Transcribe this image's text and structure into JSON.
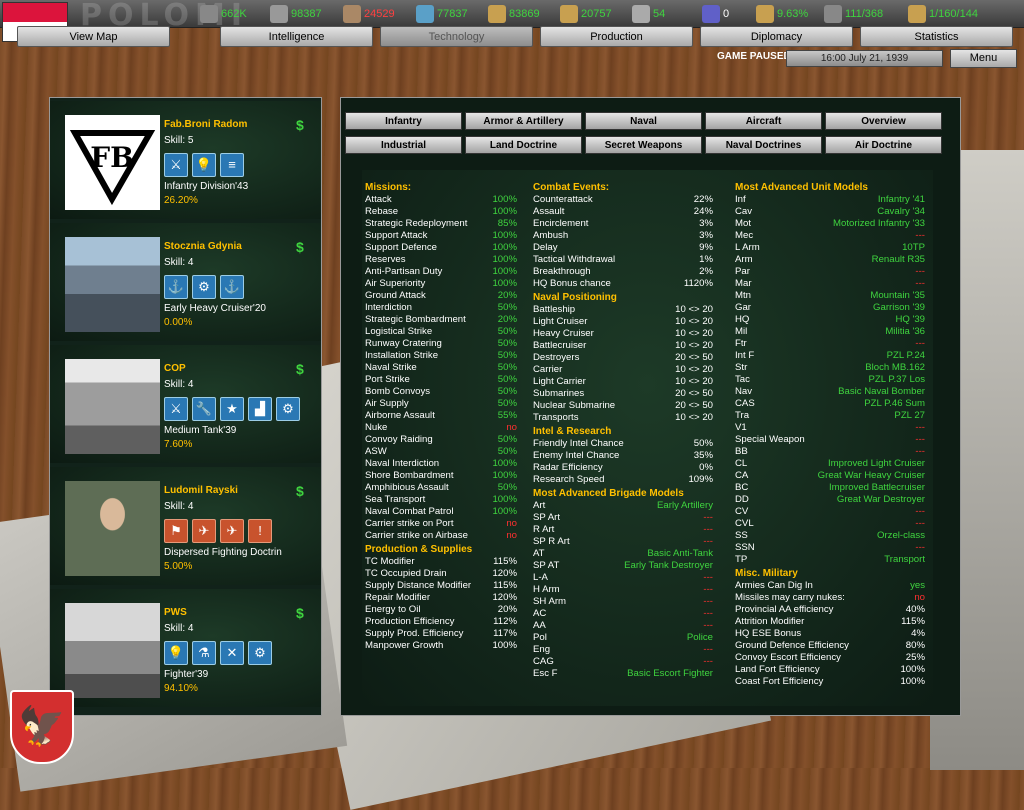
{
  "header": {
    "country_name": "POLOMI",
    "resources": [
      {
        "icon": "leadership-icon",
        "value": "662K"
      },
      {
        "icon": "energy-icon",
        "value": "98387"
      },
      {
        "icon": "metal-icon",
        "value": "24529"
      },
      {
        "icon": "rare-materials-icon",
        "value": "77837"
      },
      {
        "icon": "crude-oil-icon",
        "value": "83869"
      },
      {
        "icon": "supplies-icon",
        "value": "20757"
      },
      {
        "icon": "manpower-icon",
        "value": "54"
      },
      {
        "icon": "nuclear-icon",
        "value": "0"
      },
      {
        "icon": "dissent-icon",
        "value": "9.63%"
      },
      {
        "icon": "convoy-icon",
        "value": "111/368"
      },
      {
        "icon": "research-icon",
        "value": "1/160/144"
      }
    ],
    "tabs": [
      "View Map",
      "Intelligence",
      "Technology",
      "Production",
      "Diplomacy",
      "Statistics"
    ],
    "status": "GAME PAUSED",
    "date": "16:00 July 21, 1939",
    "menu": "Menu"
  },
  "teams": [
    {
      "name": "Fab.Broni Radom",
      "skill": "Skill: 5",
      "model": "Infantry Division'43",
      "pct": "26.20%",
      "icons": [
        "infantry-icon",
        "research-bulb-icon",
        "document-icon"
      ],
      "red": false
    },
    {
      "name": "Stocznia Gdynia",
      "skill": "Skill: 4",
      "model": "Early Heavy Cruiser'20",
      "pct": "0.00%",
      "icons": [
        "anchor-icon",
        "gears-icon",
        "ship-icon"
      ],
      "red": false
    },
    {
      "name": "COP",
      "skill": "Skill: 4",
      "model": "Medium Tank'39",
      "pct": "7.60%",
      "icons": [
        "infantry-icon",
        "wrench-icon",
        "star-icon",
        "industry-icon",
        "gears-icon"
      ],
      "red": false
    },
    {
      "name": "Ludomil Rayski",
      "skill": "Skill: 4",
      "model": "Dispersed Fighting Doctrin",
      "pct": "5.00%",
      "icons": [
        "hq-icon",
        "artillery-icon",
        "fighter-plane-icon",
        "marker-icon"
      ],
      "red": true
    },
    {
      "name": "PWS",
      "skill": "Skill: 4",
      "model": "Fighter'39",
      "pct": "94.10%",
      "icons": [
        "research-bulb-icon",
        "flask-icon",
        "propeller-icon",
        "gears-icon"
      ],
      "red": false
    }
  ],
  "category_tabs": [
    [
      "Infantry",
      "Armor & Artillery",
      "Naval",
      "Aircraft",
      "Overview"
    ],
    [
      "Industrial",
      "Land Doctrine",
      "Secret Weapons",
      "Naval Doctrines",
      "Air Doctrine"
    ]
  ],
  "col1": [
    {
      "h": "Missions:"
    },
    {
      "l": "Attack",
      "v": "100%"
    },
    {
      "l": "Rebase",
      "v": "100%"
    },
    {
      "l": "Strategic Redeployment",
      "v": "85%"
    },
    {
      "l": "Support Attack",
      "v": "100%"
    },
    {
      "l": "Support Defence",
      "v": "100%"
    },
    {
      "l": "Reserves",
      "v": "100%"
    },
    {
      "l": "Anti-Partisan Duty",
      "v": "100%"
    },
    {
      "l": "Air Superiority",
      "v": "100%"
    },
    {
      "l": "Ground Attack",
      "v": "20%"
    },
    {
      "l": "Interdiction",
      "v": "50%"
    },
    {
      "l": "Strategic Bombardment",
      "v": "20%"
    },
    {
      "l": "Logistical Strike",
      "v": "50%"
    },
    {
      "l": "Runway Cratering",
      "v": "50%"
    },
    {
      "l": "Installation Strike",
      "v": "50%"
    },
    {
      "l": "Naval Strike",
      "v": "50%"
    },
    {
      "l": "Port Strike",
      "v": "50%"
    },
    {
      "l": "Bomb Convoys",
      "v": "50%"
    },
    {
      "l": "Air Supply",
      "v": "50%"
    },
    {
      "l": "Airborne Assault",
      "v": "55%"
    },
    {
      "l": "Nuke",
      "v": "no",
      "c": "red"
    },
    {
      "l": "Convoy Raiding",
      "v": "50%"
    },
    {
      "l": "ASW",
      "v": "50%"
    },
    {
      "l": "Naval Interdiction",
      "v": "100%"
    },
    {
      "l": "Shore Bombardment",
      "v": "100%"
    },
    {
      "l": "Amphibious Assault",
      "v": "50%"
    },
    {
      "l": "Sea Transport",
      "v": "100%"
    },
    {
      "l": "Naval Combat Patrol",
      "v": "100%"
    },
    {
      "l": "Carrier strike on Port",
      "v": "no",
      "c": "red"
    },
    {
      "l": "Carrier strike on Airbase",
      "v": "no",
      "c": "red"
    },
    {
      "h": "Production & Supplies"
    },
    {
      "l": "TC Modifier",
      "v": "115%",
      "c": "white"
    },
    {
      "l": "TC Occupied Drain",
      "v": "120%",
      "c": "white"
    },
    {
      "l": "Supply Distance Modifier",
      "v": "115%",
      "c": "white"
    },
    {
      "l": "Repair Modifier",
      "v": "120%",
      "c": "white"
    },
    {
      "l": "Energy to Oil",
      "v": "20%",
      "c": "white"
    },
    {
      "l": "Production Efficiency",
      "v": "112%",
      "c": "white"
    },
    {
      "l": "Supply Prod. Efficiency",
      "v": "117%",
      "c": "white"
    },
    {
      "l": "Manpower Growth",
      "v": "100%",
      "c": "white"
    }
  ],
  "col2": [
    {
      "h": "Combat Events:"
    },
    {
      "l": "Counterattack",
      "v": "22%",
      "c": "white"
    },
    {
      "l": "Assault",
      "v": "24%",
      "c": "white"
    },
    {
      "l": "Encirclement",
      "v": "3%",
      "c": "white"
    },
    {
      "l": "Ambush",
      "v": "3%",
      "c": "white"
    },
    {
      "l": "Delay",
      "v": "9%",
      "c": "white"
    },
    {
      "l": "Tactical Withdrawal",
      "v": "1%",
      "c": "white"
    },
    {
      "l": "Breakthrough",
      "v": "2%",
      "c": "white"
    },
    {
      "l": "HQ Bonus chance",
      "v": "1120%",
      "c": "white"
    },
    {
      "h": "Naval Positioning"
    },
    {
      "l": "Battleship",
      "v": "10 <> 20",
      "c": "white"
    },
    {
      "l": "Light Cruiser",
      "v": "10 <> 20",
      "c": "white"
    },
    {
      "l": "Heavy Cruiser",
      "v": "10 <> 20",
      "c": "white"
    },
    {
      "l": "Battlecruiser",
      "v": "10 <> 20",
      "c": "white"
    },
    {
      "l": "Destroyers",
      "v": "20 <> 50",
      "c": "white"
    },
    {
      "l": "Carrier",
      "v": "10 <> 20",
      "c": "white"
    },
    {
      "l": "Light Carrier",
      "v": "10 <> 20",
      "c": "white"
    },
    {
      "l": "Submarines",
      "v": "20 <> 50",
      "c": "white"
    },
    {
      "l": "Nuclear Submarine",
      "v": "20 <> 50",
      "c": "white"
    },
    {
      "l": "Transports",
      "v": "10 <> 20",
      "c": "white"
    },
    {
      "h": "Intel & Research"
    },
    {
      "l": "Friendly Intel Chance",
      "v": "50%",
      "c": "white"
    },
    {
      "l": "Enemy Intel Chance",
      "v": "35%",
      "c": "white"
    },
    {
      "l": "Radar Efficiency",
      "v": "0%",
      "c": "white"
    },
    {
      "l": "Research Speed",
      "v": "109%",
      "c": "white"
    },
    {
      "h": "Most Advanced Brigade Models"
    },
    {
      "l": "Art",
      "v": "Early Artillery"
    },
    {
      "l": "SP Art",
      "v": "---",
      "c": "red"
    },
    {
      "l": "R Art",
      "v": "---",
      "c": "red"
    },
    {
      "l": "SP R Art",
      "v": "---",
      "c": "red"
    },
    {
      "l": "AT",
      "v": "Basic Anti-Tank"
    },
    {
      "l": "SP AT",
      "v": "Early Tank Destroyer"
    },
    {
      "l": "L-A",
      "v": "---",
      "c": "red"
    },
    {
      "l": "H Arm",
      "v": "---",
      "c": "red"
    },
    {
      "l": "SH Arm",
      "v": "---",
      "c": "red"
    },
    {
      "l": "AC",
      "v": "---",
      "c": "red"
    },
    {
      "l": "AA",
      "v": "---",
      "c": "red"
    },
    {
      "l": "Pol",
      "v": "Police"
    },
    {
      "l": "Eng",
      "v": "---",
      "c": "red"
    },
    {
      "l": "CAG",
      "v": "---",
      "c": "red"
    },
    {
      "l": "Esc F",
      "v": "Basic Escort Fighter"
    }
  ],
  "col3": [
    {
      "h": "Most Advanced Unit Models"
    },
    {
      "l": "Inf",
      "v": "Infantry '41"
    },
    {
      "l": "Cav",
      "v": "Cavalry '34"
    },
    {
      "l": "Mot",
      "v": "Motorized Infantry '33"
    },
    {
      "l": "Mec",
      "v": "---",
      "c": "red"
    },
    {
      "l": "L Arm",
      "v": "10TP"
    },
    {
      "l": "Arm",
      "v": "Renault R35"
    },
    {
      "l": "Par",
      "v": "---",
      "c": "red"
    },
    {
      "l": "Mar",
      "v": "---",
      "c": "red"
    },
    {
      "l": "Mtn",
      "v": "Mountain '35"
    },
    {
      "l": "Gar",
      "v": "Garrison '39"
    },
    {
      "l": "HQ",
      "v": "HQ '39"
    },
    {
      "l": "Mil",
      "v": "Militia '36"
    },
    {
      "l": "Ftr",
      "v": "---",
      "c": "red"
    },
    {
      "l": "Int F",
      "v": "PZL P.24"
    },
    {
      "l": "Str",
      "v": "Bloch MB.162"
    },
    {
      "l": "Tac",
      "v": "PZL P.37 Los"
    },
    {
      "l": "Nav",
      "v": "Basic Naval Bomber"
    },
    {
      "l": "CAS",
      "v": "PZL P.46 Sum"
    },
    {
      "l": "Tra",
      "v": "PZL 27"
    },
    {
      "l": "V1",
      "v": "---",
      "c": "red"
    },
    {
      "l": "Special Weapon",
      "v": "---",
      "c": "red"
    },
    {
      "l": "BB",
      "v": "---",
      "c": "red"
    },
    {
      "l": "CL",
      "v": "Improved Light Cruiser"
    },
    {
      "l": "CA",
      "v": "Great War Heavy Cruiser"
    },
    {
      "l": "BC",
      "v": "Improved Battlecruiser"
    },
    {
      "l": "DD",
      "v": "Great War Destroyer"
    },
    {
      "l": "CV",
      "v": "---",
      "c": "red"
    },
    {
      "l": "CVL",
      "v": "---",
      "c": "red"
    },
    {
      "l": "SS",
      "v": "Orzel-class"
    },
    {
      "l": "SSN",
      "v": "---",
      "c": "red"
    },
    {
      "l": "TP",
      "v": "Transport"
    },
    {
      "h": "Misc. Military"
    },
    {
      "l": "Armies Can Dig In",
      "v": "yes"
    },
    {
      "l": "Missiles may carry nukes:",
      "v": "no",
      "c": "red"
    },
    {
      "l": "Provincial AA efficiency",
      "v": "40%",
      "c": "white"
    },
    {
      "l": "Attrition Modifier",
      "v": "115%",
      "c": "white"
    },
    {
      "l": "HQ ESE Bonus",
      "v": "4%",
      "c": "white"
    },
    {
      "l": "Ground Defence Efficiency",
      "v": "80%",
      "c": "white"
    },
    {
      "l": "Convoy Escort Efficiency",
      "v": "25%",
      "c": "white"
    },
    {
      "l": "Land Fort Efficiency",
      "v": "100%",
      "c": "white"
    },
    {
      "l": "Coast Fort Efficiency",
      "v": "100%",
      "c": "white"
    }
  ]
}
